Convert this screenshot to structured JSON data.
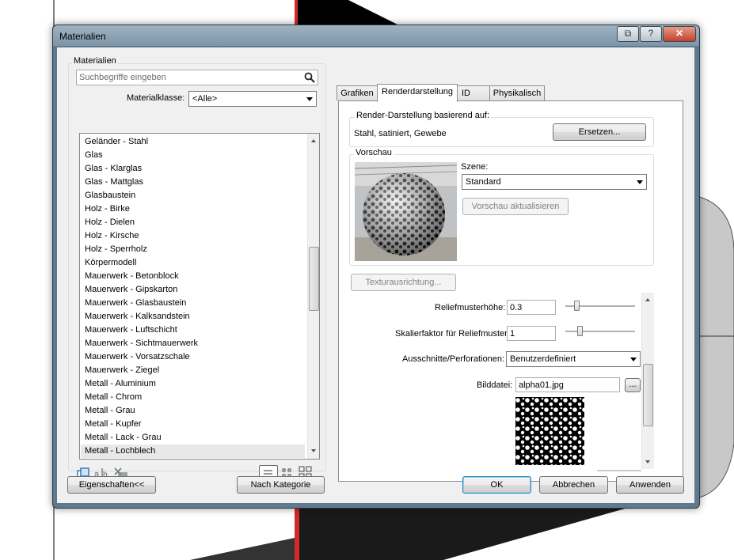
{
  "window": {
    "title": "Materialien"
  },
  "left": {
    "group_label": "Materialien",
    "search": {
      "placeholder": "Suchbegriffe eingeben",
      "icon": "search-icon"
    },
    "class_label": "Materialklasse:",
    "class_value": "<Alle>",
    "items": [
      "Geländer - Stahl",
      "Glas",
      "Glas - Klarglas",
      "Glas - Mattglas",
      "Glasbaustein",
      "Holz - Birke",
      "Holz - Dielen",
      "Holz - Kirsche",
      "Holz - Sperrholz",
      "Körpermodell",
      "Mauerwerk - Betonblock",
      "Mauerwerk - Gipskarton",
      "Mauerwerk - Glasbaustein",
      "Mauerwerk - Kalksandstein",
      "Mauerwerk - Luftschicht",
      "Mauerwerk - Sichtmauerwerk",
      "Mauerwerk - Vorsatzschale",
      "Mauerwerk - Ziegel",
      "Metall - Aluminium",
      "Metall - Chrom",
      "Metall - Grau",
      "Metall - Kupfer",
      "Metall - Lack - Grau",
      "Metall - Lochblech"
    ],
    "selected_item": "Metall - Lochblech",
    "toolbar_icons": [
      "duplicate-icon",
      "rename-icon",
      "delete-icon",
      "list-view-icon",
      "small-icons-view-icon",
      "large-icons-view-icon"
    ]
  },
  "tabs": [
    "Grafiken",
    "Renderdarstellung",
    "ID",
    "Physikalisch"
  ],
  "active_tab": "Renderdarstellung",
  "render": {
    "based_on_label": "Render-Darstellung basierend auf:",
    "based_on_value": "Stahl, satiniert, Gewebe",
    "replace_button": "Ersetzen...",
    "preview_label": "Vorschau",
    "scene_label": "Szene:",
    "scene_value": "Standard",
    "update_preview_button": "Vorschau aktualisieren",
    "texture_alignment_button": "Texturausrichtung...",
    "relief_height_label": "Reliefmusterhöhe:",
    "relief_height_value": "0.3",
    "relief_scale_label": "Skalierfaktor für Reliefmuster",
    "relief_scale_value": "1",
    "cutouts_label": "Ausschnitte/Perforationen:",
    "cutouts_value": "Benutzerdefiniert",
    "image_file_label": "Bilddatei:",
    "image_file_value": "alpha01.jpg",
    "browse_button": "..."
  },
  "footer": {
    "properties_button": "Eigenschaften<<",
    "by_category_button": "Nach Kategorie",
    "ok_button": "OK",
    "cancel_button": "Abbrechen",
    "apply_button": "Anwenden"
  },
  "colors": {
    "accent": "#3c7fb1",
    "viewport_red": "#d42a2a"
  }
}
